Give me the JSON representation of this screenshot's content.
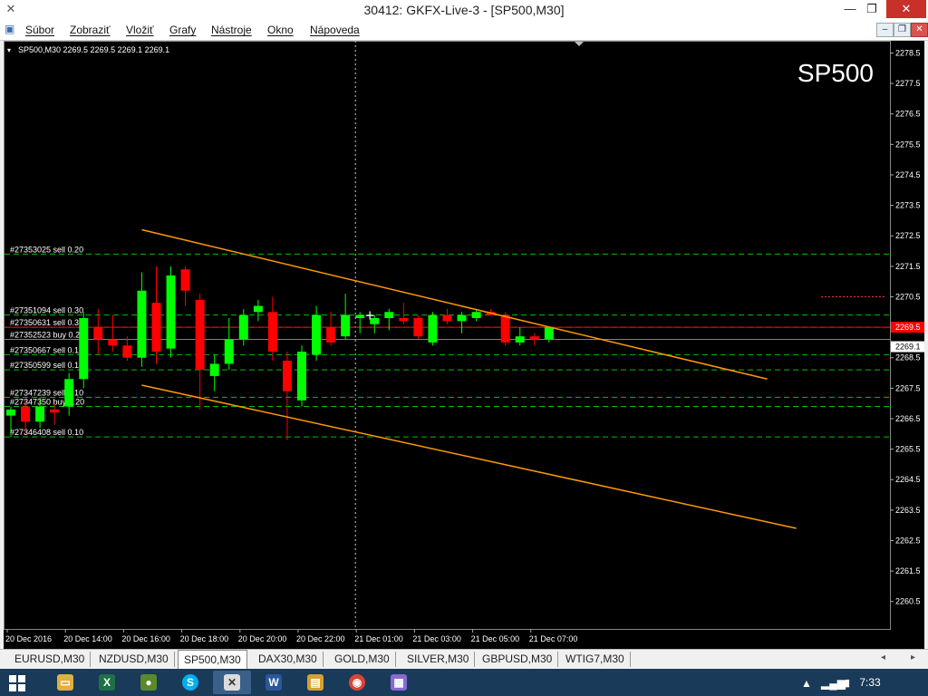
{
  "window": {
    "title": "30412: GKFX-Live-3 - [SP500,M30]",
    "controls": {
      "minimize": "—",
      "restore": "❐",
      "close": "✕"
    }
  },
  "menu": {
    "items": [
      "Súbor",
      "Zobraziť",
      "Vložiť",
      "Grafy",
      "Nástroje",
      "Okno",
      "Nápoveda"
    ]
  },
  "chart_data": {
    "type": "candlestick",
    "symbol_header": "SP500,M30  2269.5 2269.5 2269.1 2269.1",
    "watermark": "SP500",
    "y_range": [
      2259.6,
      2278.9
    ],
    "y_ticks": [
      "2278.5",
      "2277.5",
      "2276.5",
      "2275.5",
      "2274.5",
      "2273.5",
      "2272.5",
      "2271.5",
      "2270.5",
      "2269.5",
      "2268.5",
      "2267.5",
      "2266.5",
      "2265.5",
      "2264.5",
      "2263.5",
      "2262.5",
      "2261.5",
      "2260.5"
    ],
    "bid_price": "2269.5",
    "ask_price": "2269.1",
    "time_labels": [
      {
        "label": "20 Dec 2016",
        "bar": 0
      },
      {
        "label": "20 Dec 14:00",
        "bar": 4
      },
      {
        "label": "20 Dec 16:00",
        "bar": 8
      },
      {
        "label": "20 Dec 18:00",
        "bar": 12
      },
      {
        "label": "20 Dec 20:00",
        "bar": 16
      },
      {
        "label": "20 Dec 22:00",
        "bar": 20
      },
      {
        "label": "21 Dec 01:00",
        "bar": 24
      },
      {
        "label": "21 Dec 03:00",
        "bar": 28
      },
      {
        "label": "21 Dec 05:00",
        "bar": 32
      },
      {
        "label": "21 Dec 07:00",
        "bar": 36
      }
    ],
    "candles": [
      {
        "o": 2266.6,
        "h": 2266.9,
        "l": 2265.9,
        "c": 2266.8
      },
      {
        "o": 2266.9,
        "h": 2267.1,
        "l": 2266.0,
        "c": 2266.4
      },
      {
        "o": 2266.4,
        "h": 2267.2,
        "l": 2266.2,
        "c": 2266.9
      },
      {
        "o": 2266.8,
        "h": 2267.0,
        "l": 2266.3,
        "c": 2266.7
      },
      {
        "o": 2266.9,
        "h": 2268.0,
        "l": 2266.6,
        "c": 2267.8
      },
      {
        "o": 2267.8,
        "h": 2270.0,
        "l": 2267.5,
        "c": 2269.8
      },
      {
        "o": 2269.5,
        "h": 2270.1,
        "l": 2268.6,
        "c": 2269.1
      },
      {
        "o": 2269.1,
        "h": 2269.9,
        "l": 2268.7,
        "c": 2268.9
      },
      {
        "o": 2268.9,
        "h": 2269.2,
        "l": 2268.4,
        "c": 2268.5
      },
      {
        "o": 2268.5,
        "h": 2271.3,
        "l": 2268.2,
        "c": 2270.7
      },
      {
        "o": 2270.3,
        "h": 2271.5,
        "l": 2268.3,
        "c": 2268.7
      },
      {
        "o": 2268.8,
        "h": 2271.5,
        "l": 2268.5,
        "c": 2271.2
      },
      {
        "o": 2271.4,
        "h": 2271.5,
        "l": 2270.2,
        "c": 2270.7
      },
      {
        "o": 2270.4,
        "h": 2270.6,
        "l": 2266.8,
        "c": 2268.1
      },
      {
        "o": 2267.9,
        "h": 2268.6,
        "l": 2267.4,
        "c": 2268.3
      },
      {
        "o": 2268.3,
        "h": 2269.8,
        "l": 2268.1,
        "c": 2269.1
      },
      {
        "o": 2269.1,
        "h": 2270.1,
        "l": 2268.9,
        "c": 2269.9
      },
      {
        "o": 2270.0,
        "h": 2270.4,
        "l": 2269.7,
        "c": 2270.2
      },
      {
        "o": 2270.0,
        "h": 2270.5,
        "l": 2268.4,
        "c": 2268.7
      },
      {
        "o": 2268.4,
        "h": 2268.7,
        "l": 2265.8,
        "c": 2267.4
      },
      {
        "o": 2267.1,
        "h": 2268.9,
        "l": 2266.9,
        "c": 2268.7
      },
      {
        "o": 2268.6,
        "h": 2270.2,
        "l": 2268.4,
        "c": 2269.9
      },
      {
        "o": 2269.5,
        "h": 2270.0,
        "l": 2268.9,
        "c": 2269.0
      },
      {
        "o": 2269.2,
        "h": 2270.6,
        "l": 2269.1,
        "c": 2269.9
      },
      {
        "o": 2269.8,
        "h": 2270.0,
        "l": 2269.3,
        "c": 2269.9
      },
      {
        "o": 2269.6,
        "h": 2269.9,
        "l": 2269.3,
        "c": 2269.8
      },
      {
        "o": 2269.8,
        "h": 2270.1,
        "l": 2269.4,
        "c": 2270.0
      },
      {
        "o": 2269.8,
        "h": 2270.3,
        "l": 2269.6,
        "c": 2269.7
      },
      {
        "o": 2269.8,
        "h": 2269.9,
        "l": 2269.1,
        "c": 2269.2
      },
      {
        "o": 2269.0,
        "h": 2270.0,
        "l": 2268.9,
        "c": 2269.9
      },
      {
        "o": 2269.9,
        "h": 2270.1,
        "l": 2269.6,
        "c": 2269.7
      },
      {
        "o": 2269.7,
        "h": 2270.0,
        "l": 2269.3,
        "c": 2269.9
      },
      {
        "o": 2269.8,
        "h": 2270.1,
        "l": 2269.7,
        "c": 2270.0
      },
      {
        "o": 2270.0,
        "h": 2270.1,
        "l": 2269.9,
        "c": 2269.9
      },
      {
        "o": 2269.9,
        "h": 2270.0,
        "l": 2268.9,
        "c": 2269.0
      },
      {
        "o": 2269.0,
        "h": 2269.5,
        "l": 2268.9,
        "c": 2269.2
      },
      {
        "o": 2269.2,
        "h": 2269.3,
        "l": 2268.9,
        "c": 2269.1
      },
      {
        "o": 2269.1,
        "h": 2269.5,
        "l": 2269.0,
        "c": 2269.5
      }
    ],
    "trendlines": [
      {
        "start": {
          "bar": 9,
          "price": 2272.7
        },
        "end": {
          "bar": 52,
          "price": 2267.8
        }
      },
      {
        "start": {
          "bar": 9,
          "price": 2267.6
        },
        "end": {
          "bar": 54,
          "price": 2262.9
        }
      }
    ],
    "orders": [
      {
        "label": "#27353025 sell 0.20",
        "price": 2271.9
      },
      {
        "label": "#27351094 sell 0.30",
        "price": 2269.9
      },
      {
        "label": "#27350631 sell 0.30",
        "price": 2269.5
      },
      {
        "label": "#27352523 buy 0.20",
        "price": 2269.1
      },
      {
        "label": "#27350667 sell 0.10",
        "price": 2268.6
      },
      {
        "label": "#27350599 sell 0.10",
        "price": 2268.1
      },
      {
        "label": "#27347239 sell 0.10",
        "price": 2267.2
      },
      {
        "label": "#27347350 buy 0.20",
        "price": 2266.9
      },
      {
        "label": "#27346408 sell 0.10",
        "price": 2265.9
      }
    ]
  },
  "tabs": {
    "items": [
      "EURUSD,M30",
      "NZDUSD,M30",
      "SP500,M30",
      "DAX30,M30",
      "GOLD,M30",
      "SILVER,M30",
      "GBPUSD,M30",
      "WTIG7,M30"
    ],
    "active": "SP500,M30"
  },
  "taskbar": {
    "clock": "7:33",
    "apps": [
      "file-explorer",
      "excel",
      "mt4-green",
      "skype",
      "mt4-active",
      "word",
      "folder",
      "chrome",
      "app-store"
    ]
  },
  "colors": {
    "bull": "#00ff00",
    "bear": "#ff0000",
    "grid": "#444444",
    "order_line": "#00c000",
    "trendline": "#ff9900",
    "bid_line": "#ff0000",
    "ask_line": "#808080",
    "taskbar": "#1a3a5a"
  }
}
